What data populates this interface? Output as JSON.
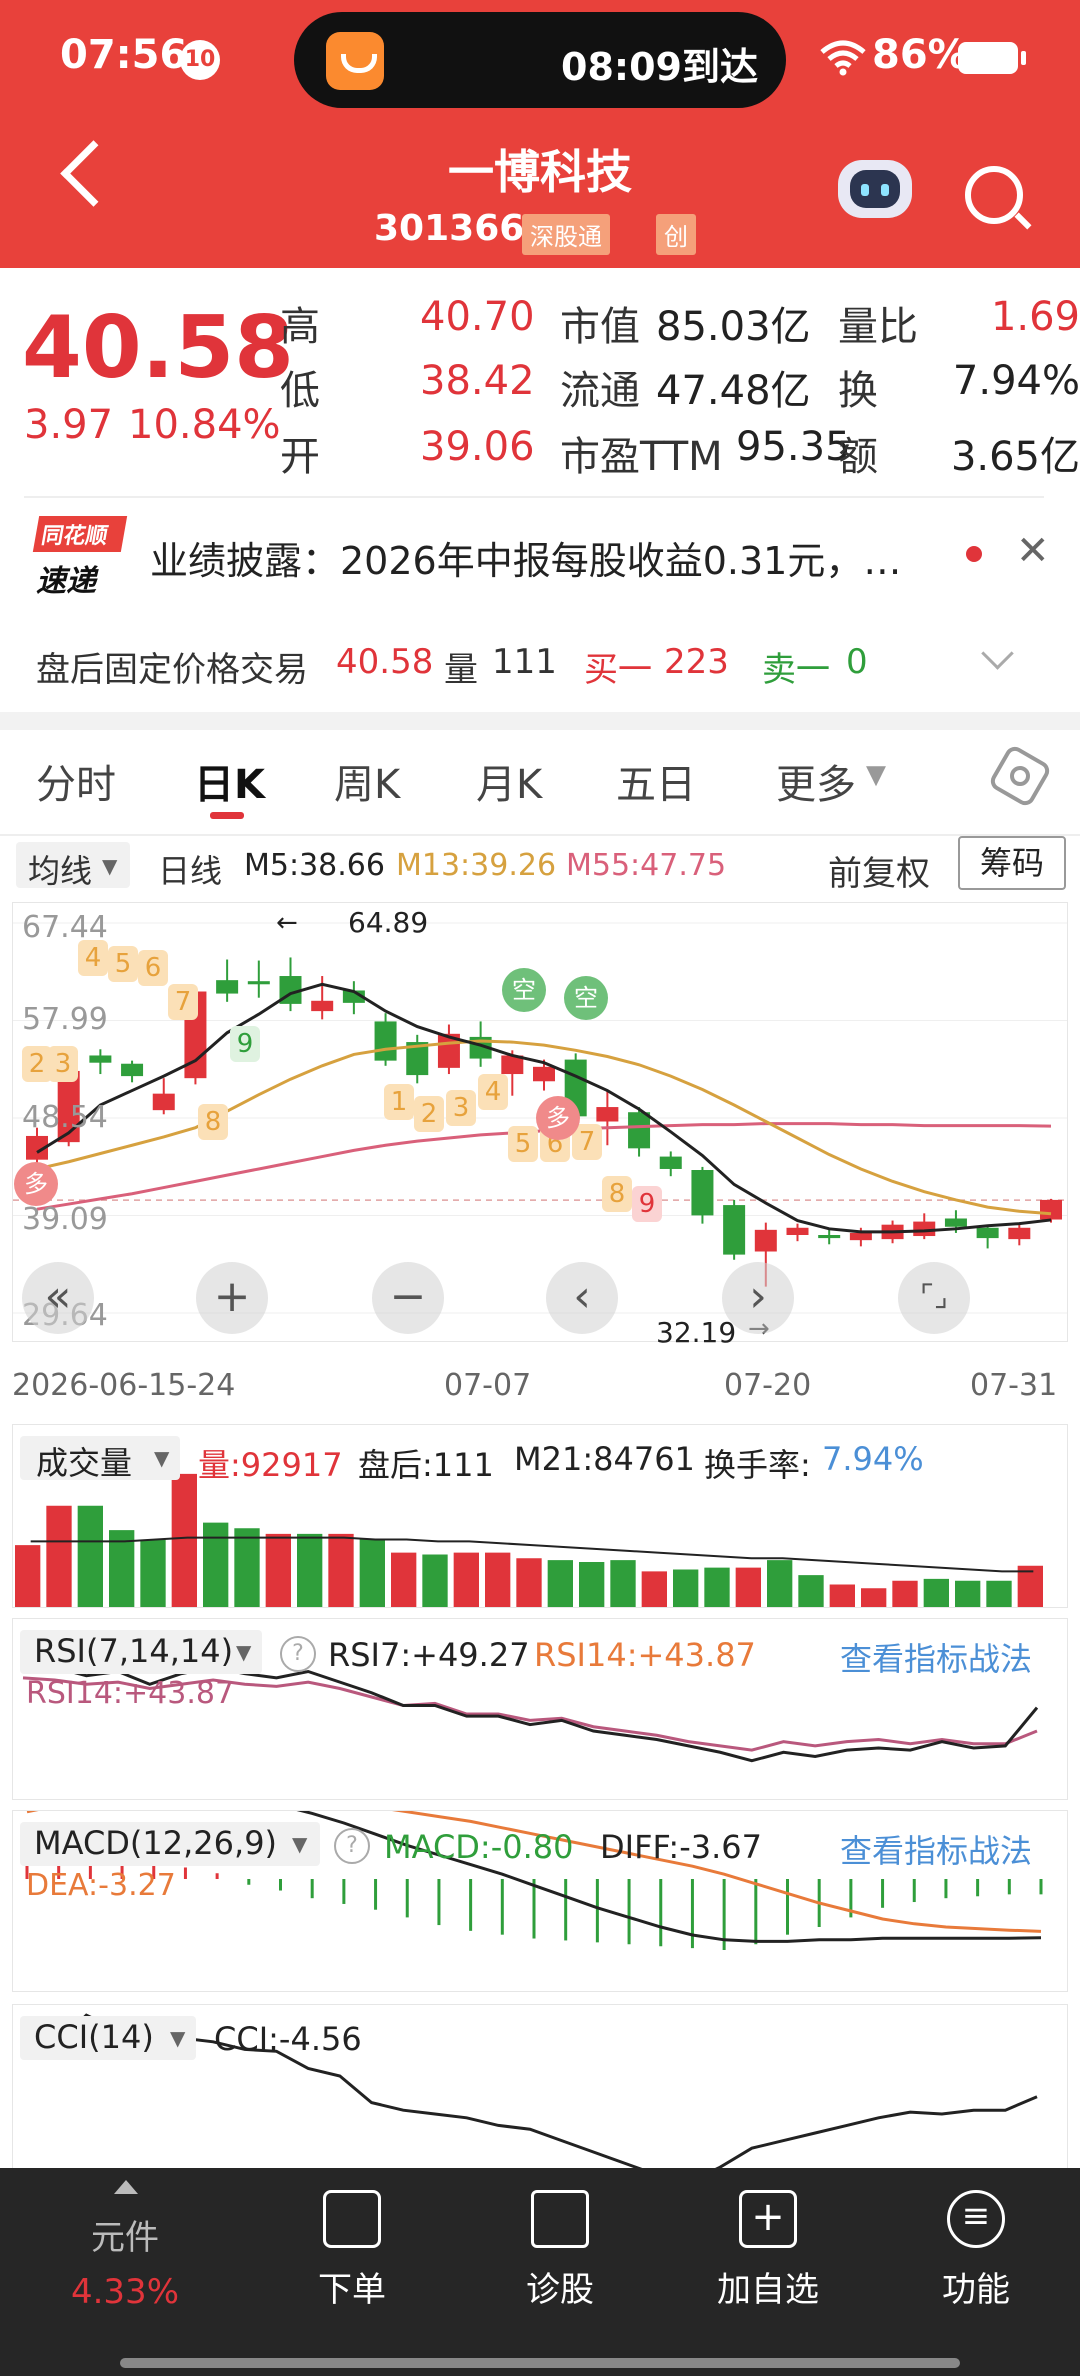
{
  "status": {
    "time": "07:56",
    "notif_badge": "10",
    "eta": "08:09到达",
    "battery": "86%"
  },
  "header": {
    "title": "一博科技",
    "code": "301366",
    "tag1": "深股通",
    "tag2": "创"
  },
  "quote": {
    "price": "40.58",
    "change": "3.97",
    "change_pct": "10.84%",
    "labels": {
      "high": "高",
      "low": "低",
      "open": "开",
      "mcap": "市值",
      "float": "流通",
      "pe": "市盈TTM",
      "vol_ratio": "量比",
      "turnover": "换",
      "amount": "额"
    },
    "high": "40.70",
    "low": "38.42",
    "open": "39.06",
    "mcap": "85.03亿",
    "float": "47.48亿",
    "pe": "95.35",
    "vol_ratio": "1.69",
    "turnover": "7.94%",
    "amount": "3.65亿"
  },
  "news": {
    "source_line1": "同花顺",
    "source_line2": "速递",
    "text": "业绩披露：2026年中报每股收益0.31元，…"
  },
  "after_hours": {
    "label": "盘后固定价格交易",
    "price": "40.58",
    "vol_label": "量",
    "vol": "111",
    "buy_label": "买一",
    "buy": "223",
    "sell_label": "卖一",
    "sell": "0"
  },
  "tabs": [
    "分时",
    "日K",
    "周K",
    "月K",
    "五日",
    "更多"
  ],
  "active_tab": "日K",
  "ma_bar": {
    "selector": "均线",
    "period": "日线",
    "m5": "M5:38.66",
    "m13": "M13:39.26",
    "m55": "M55:47.75",
    "adjust": "前复权",
    "chips": "筹码"
  },
  "kline": {
    "y_labels": [
      "67.44",
      "57.99",
      "48.54",
      "39.09",
      "29.64"
    ],
    "max_label": "64.89",
    "min_label": "32.19",
    "dates": [
      "2026-06-15-24",
      "07-07",
      "07-20",
      "07-31"
    ],
    "colors": {
      "up": "#e0343a",
      "down": "#2f9e3b",
      "ma5": "#222222",
      "ma13": "#d6a13f",
      "ma55": "#d9607a"
    },
    "candles": [
      {
        "o": 44.5,
        "c": 46.8,
        "h": 47.6,
        "l": 43.9
      },
      {
        "o": 46.2,
        "c": 53.1,
        "h": 53.8,
        "l": 45.8
      },
      {
        "o": 54.6,
        "c": 53.9,
        "h": 55.2,
        "l": 52.8
      },
      {
        "o": 53.8,
        "c": 52.6,
        "h": 54.1,
        "l": 52.0
      },
      {
        "o": 49.3,
        "c": 50.9,
        "h": 52.4,
        "l": 48.9
      },
      {
        "o": 52.4,
        "c": 60.8,
        "h": 61.2,
        "l": 51.8
      },
      {
        "o": 61.9,
        "c": 60.6,
        "h": 63.9,
        "l": 59.8
      },
      {
        "o": 61.8,
        "c": 61.5,
        "h": 63.8,
        "l": 60.2
      },
      {
        "o": 62.3,
        "c": 59.6,
        "h": 64.1,
        "l": 58.9
      },
      {
        "o": 58.9,
        "c": 59.9,
        "h": 62.3,
        "l": 58.1
      },
      {
        "o": 60.9,
        "c": 59.7,
        "h": 61.8,
        "l": 58.6
      },
      {
        "o": 57.9,
        "c": 54.1,
        "h": 58.7,
        "l": 53.6
      },
      {
        "o": 55.9,
        "c": 52.7,
        "h": 56.6,
        "l": 51.9
      },
      {
        "o": 53.4,
        "c": 56.7,
        "h": 57.6,
        "l": 52.8
      },
      {
        "o": 56.4,
        "c": 54.3,
        "h": 57.9,
        "l": 53.5
      },
      {
        "o": 52.8,
        "c": 54.6,
        "h": 55.1,
        "l": 50.7
      },
      {
        "o": 52.1,
        "c": 53.5,
        "h": 54.2,
        "l": 51.2
      },
      {
        "o": 54.2,
        "c": 48.7,
        "h": 54.8,
        "l": 47.9
      },
      {
        "o": 48.2,
        "c": 49.6,
        "h": 51.3,
        "l": 45.9
      },
      {
        "o": 49.1,
        "c": 45.6,
        "h": 49.6,
        "l": 44.8
      },
      {
        "o": 44.8,
        "c": 43.6,
        "h": 45.3,
        "l": 42.9
      },
      {
        "o": 43.5,
        "c": 39.1,
        "h": 43.8,
        "l": 38.3
      },
      {
        "o": 40.1,
        "c": 35.3,
        "h": 40.6,
        "l": 34.8
      },
      {
        "o": 35.6,
        "c": 37.7,
        "h": 38.4,
        "l": 32.2
      },
      {
        "o": 37.2,
        "c": 37.9,
        "h": 38.3,
        "l": 36.6
      },
      {
        "o": 37.2,
        "c": 36.9,
        "h": 37.8,
        "l": 36.3
      },
      {
        "o": 36.7,
        "c": 37.4,
        "h": 37.9,
        "l": 36.1
      },
      {
        "o": 36.8,
        "c": 38.2,
        "h": 38.6,
        "l": 36.4
      },
      {
        "o": 37.1,
        "c": 38.5,
        "h": 39.3,
        "l": 36.8
      },
      {
        "o": 38.8,
        "c": 38.0,
        "h": 39.6,
        "l": 37.4
      },
      {
        "o": 37.9,
        "c": 36.9,
        "h": 38.2,
        "l": 35.9
      },
      {
        "o": 36.8,
        "c": 37.9,
        "h": 38.4,
        "l": 36.2
      },
      {
        "o": 38.7,
        "c": 40.6,
        "h": 40.7,
        "l": 38.4
      }
    ],
    "ma5": [
      45.2,
      47.1,
      49.8,
      51.2,
      52.6,
      54.1,
      56.8,
      58.6,
      60.6,
      61.5,
      60.8,
      58.9,
      57.4,
      56.4,
      55.6,
      54.6,
      53.9,
      52.6,
      51.2,
      49.4,
      47.2,
      44.9,
      42.1,
      40.3,
      38.6,
      37.8,
      37.5,
      37.5,
      37.6,
      37.8,
      38.1,
      38.3,
      38.66
    ],
    "ma13": [
      43.6,
      44.3,
      45.1,
      45.9,
      46.7,
      47.6,
      49.2,
      50.8,
      52.3,
      53.6,
      54.7,
      55.2,
      55.5,
      55.8,
      56.0,
      55.9,
      55.6,
      55.1,
      54.5,
      53.7,
      52.6,
      51.3,
      49.8,
      48.2,
      46.6,
      45.0,
      43.6,
      42.4,
      41.4,
      40.6,
      39.9,
      39.5,
      39.26
    ],
    "ma55": [
      39.7,
      40.2,
      40.7,
      41.2,
      41.8,
      42.4,
      43.0,
      43.6,
      44.2,
      44.8,
      45.4,
      45.9,
      46.3,
      46.6,
      46.9,
      47.1,
      47.3,
      47.5,
      47.6,
      47.7,
      47.8,
      47.9,
      47.9,
      48.0,
      48.0,
      48.0,
      47.9,
      47.9,
      47.8,
      47.8,
      47.8,
      47.8,
      47.75
    ],
    "signals": {
      "buy_nine_top": [
        "2",
        "3",
        "4",
        "5",
        "6",
        "7",
        "8",
        "9"
      ],
      "buy_nine_bottom": [
        "1",
        "2",
        "3",
        "4",
        "5",
        "6",
        "7",
        "8",
        "9"
      ],
      "duo": "多",
      "kong": "空"
    }
  },
  "controls": [
    "«",
    "+",
    "−",
    "‹",
    "›",
    "⌜⌟"
  ],
  "volume": {
    "selector": "成交量",
    "vol_label": "量:92917",
    "after": "盘后:111",
    "m21": "M21:84761",
    "turnover_label": "换手率:",
    "turnover": "7.94%",
    "bars": [
      33,
      54,
      54,
      41,
      36,
      71,
      45,
      42,
      39,
      39,
      39,
      36,
      29,
      28,
      29,
      29,
      26,
      25,
      24,
      25,
      19,
      20,
      21,
      21,
      25,
      17,
      12,
      10,
      14,
      15,
      14,
      14,
      22
    ],
    "bar_colors": [
      "up",
      "up",
      "down",
      "down",
      "down",
      "up",
      "down",
      "down",
      "up",
      "down",
      "up",
      "down",
      "up",
      "down",
      "up",
      "up",
      "up",
      "down",
      "down",
      "down",
      "up",
      "down",
      "down",
      "up",
      "down",
      "down",
      "up",
      "up",
      "up",
      "down",
      "down",
      "down",
      "up"
    ],
    "m21_line": [
      35,
      35,
      35,
      35,
      36,
      37,
      37,
      37,
      37,
      37,
      37,
      36,
      36,
      35,
      35,
      34,
      33,
      32,
      31,
      30,
      29,
      28,
      27,
      26,
      26,
      25,
      24,
      23,
      22,
      21,
      20,
      19,
      19
    ]
  },
  "rsi": {
    "selector": "RSI(7,14,14)",
    "rsi7": "RSI7:+49.27",
    "rsi14": "RSI14:+43.87",
    "rsi14_inline": "RSI14:+43.87",
    "link": "查看指标战法",
    "rsi7_vals": [
      83,
      82,
      78,
      80,
      74,
      79,
      82,
      79,
      77,
      80,
      75,
      70,
      64,
      64,
      59,
      59,
      55,
      57,
      52,
      50,
      48,
      45,
      42,
      38,
      42,
      40,
      43,
      44,
      43,
      47,
      44,
      45,
      63
    ],
    "rsi14_vals": [
      77,
      76,
      74,
      75,
      72,
      74,
      76,
      74,
      73,
      75,
      72,
      68,
      64,
      65,
      60,
      60,
      57,
      58,
      54,
      52,
      50,
      47,
      45,
      43,
      47,
      45,
      47,
      48,
      46,
      48,
      46,
      46,
      52
    ]
  },
  "macd": {
    "selector": "MACD(12,26,9)",
    "macd": "MACD:-0.80",
    "diff": "DIFF:-3.67",
    "dea_inline": "DEA:-3.27",
    "link": "查看指标战法",
    "diff_vals": [
      5.4,
      5.8,
      6.1,
      6.2,
      5.9,
      5.6,
      5.4,
      5.0,
      4.6,
      4.1,
      3.5,
      2.8,
      2.1,
      1.5,
      0.9,
      0.3,
      -0.4,
      -1.1,
      -1.8,
      -2.4,
      -3.0,
      -3.5,
      -3.8,
      -3.9,
      -3.9,
      -3.8,
      -3.8,
      -3.7,
      -3.7,
      -3.7,
      -3.7,
      -3.7,
      -3.67
    ],
    "dea_vals": [
      4.2,
      4.6,
      4.9,
      5.1,
      5.2,
      5.3,
      5.3,
      5.3,
      5.2,
      5.0,
      4.8,
      4.5,
      4.2,
      3.9,
      3.6,
      3.2,
      2.8,
      2.4,
      2.0,
      1.6,
      1.2,
      0.8,
      0.3,
      -0.3,
      -0.9,
      -1.5,
      -2.0,
      -2.5,
      -2.8,
      -3.0,
      -3.1,
      -3.2,
      -3.27
    ],
    "hist": [
      1.4,
      1.3,
      1.2,
      1.1,
      0.9,
      0.6,
      0.3,
      -0.3,
      -0.6,
      -1.0,
      -1.3,
      -1.6,
      -2.0,
      -2.4,
      -2.7,
      -2.9,
      -3.1,
      -3.2,
      -3.3,
      -3.4,
      -3.5,
      -3.6,
      -3.7,
      -3.4,
      -2.9,
      -2.5,
      -2.0,
      -1.5,
      -1.2,
      -1.0,
      -0.9,
      -0.8,
      -0.8
    ]
  },
  "cci": {
    "selector": "CCI(14)",
    "value": "CCI:-4.56",
    "vals": [
      120,
      130,
      210,
      170,
      110,
      150,
      140,
      120,
      115,
      70,
      50,
      -20,
      -40,
      -50,
      -60,
      -80,
      -90,
      -120,
      -150,
      -180,
      -210,
      -230,
      -190,
      -140,
      -120,
      -100,
      -80,
      -60,
      -45,
      -50,
      -40,
      -40,
      -4.56
    ]
  },
  "bottom_nav": {
    "element_label": "元件",
    "element_value": "4.33%",
    "items": [
      "下单",
      "诊股",
      "加自选",
      "功能"
    ]
  }
}
